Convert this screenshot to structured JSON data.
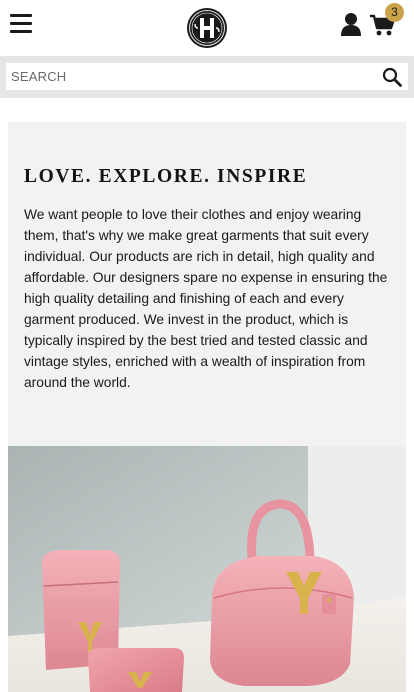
{
  "header": {
    "menu_icon": "hamburger-menu-icon",
    "logo_icon": "h-crest-logo",
    "account_icon": "user-icon",
    "cart_icon": "shopping-cart-icon",
    "cart_count": "3",
    "badge_color": "#c9a24a"
  },
  "search": {
    "placeholder": "SEARCH",
    "value": "",
    "icon": "magnifier-search-icon"
  },
  "promo": {
    "title": "LOVE. EXPLORE. INSPIRE",
    "body": "We want people to love their clothes and enjoy wearing them, that's why we make great garments that suit every individual. Our products are rich in detail, high quality and affordable. Our designers spare no expense in ensuring the high quality detailing and finishing of each and every garment produced. We invest in the product, which is typically inspired by the best tried and tested classic and vintage styles, enriched with a wealth of inspiration from around the world."
  },
  "hero": {
    "subject": "pink leather handbags with gold hardware"
  }
}
